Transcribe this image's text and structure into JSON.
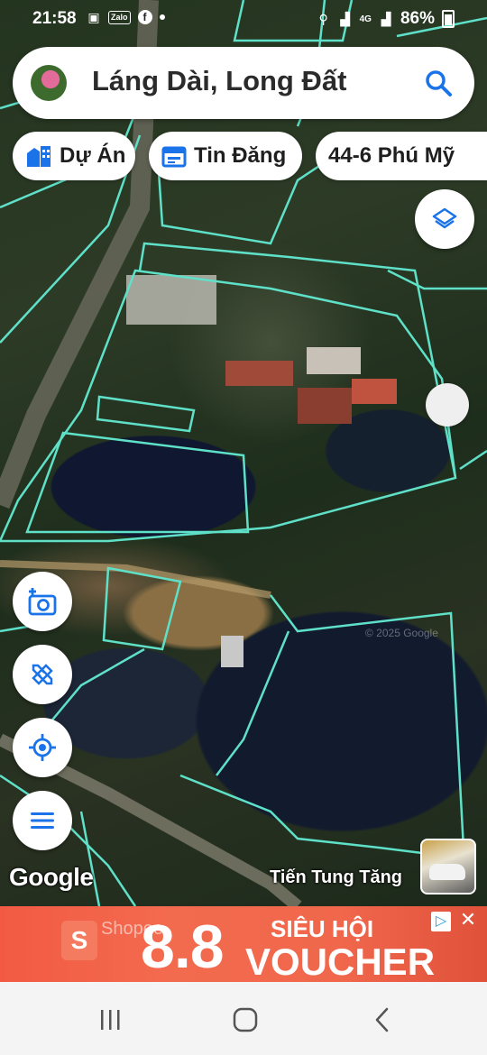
{
  "status_bar": {
    "time": "21:58",
    "zalo": "Zalo",
    "battery": "86%",
    "network": "4G"
  },
  "search": {
    "query": "Láng Dài, Long Đất"
  },
  "chips": [
    {
      "label": "Dự Án",
      "icon": "building-icon"
    },
    {
      "label": "Tin Đăng",
      "icon": "calendar-icon"
    },
    {
      "label": "44-6 Phú Mỹ",
      "icon": ""
    }
  ],
  "map": {
    "brand": "Google",
    "copyright": "© 2025 Google",
    "owner_name": "Tiến Tung Tăng"
  },
  "ad": {
    "brand": "Shopee",
    "big_text": "8.8",
    "headline": "SIÊU HỘI",
    "subheadline": "VOUCHER"
  },
  "colors": {
    "accent_blue": "#1a73e8",
    "parcel_line": "#5fe0c8",
    "ad_orange": "#f25a43"
  }
}
